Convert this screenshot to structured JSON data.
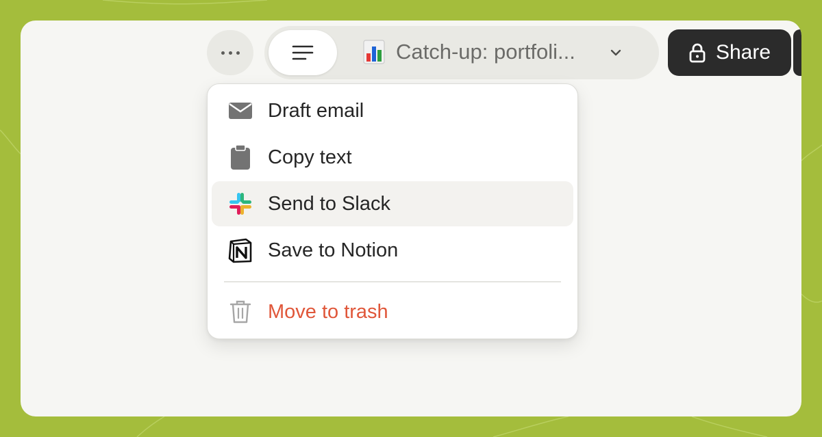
{
  "toolbar": {
    "more_icon": "ellipsis-icon",
    "outline_icon": "text-lines-icon",
    "document": {
      "icon": "bar-chart-emoji-icon",
      "title": "Catch-up: portfoli...",
      "chevron_icon": "chevron-down-icon"
    },
    "share": {
      "label": "Share",
      "icon": "lock-icon"
    }
  },
  "menu": {
    "items": [
      {
        "label": "Draft email",
        "icon": "envelope-icon"
      },
      {
        "label": "Copy text",
        "icon": "clipboard-icon"
      },
      {
        "label": "Send to Slack",
        "icon": "slack-icon",
        "hovered": true
      },
      {
        "label": "Save to Notion",
        "icon": "notion-icon"
      }
    ],
    "danger_item": {
      "label": "Move to trash",
      "icon": "trash-icon"
    }
  },
  "colors": {
    "background": "#a4bd3c",
    "window": "#f6f6f3",
    "share_button": "#2b2b2b",
    "danger": "#e0573a",
    "hover": "#f3f2ef"
  }
}
